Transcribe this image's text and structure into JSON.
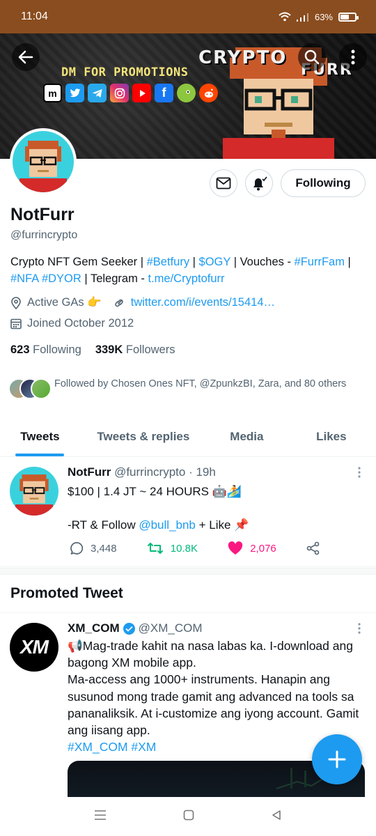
{
  "status_bar": {
    "time": "11:04",
    "battery": "63%"
  },
  "banner": {
    "title_line1": "CRYPTO",
    "title_line2": "FURR",
    "promo_text": "DM FOR PROMOTIONS",
    "social_icons": [
      "coinmarketcap-icon",
      "twitter-icon",
      "telegram-icon",
      "instagram-icon",
      "youtube-icon",
      "facebook-icon",
      "coingecko-icon",
      "reddit-icon"
    ]
  },
  "profile": {
    "name": "NotFurr",
    "handle": "@furrincrypto",
    "bio": {
      "part1": "Crypto NFT Gem Seeker | ",
      "tag_betfury": "#Betfury",
      "part2": "  | ",
      "tag_ogy": "$OGY",
      "part3": " | Vouches - ",
      "tag_furrfam": "#FurrFam",
      "part4": " | ",
      "tag_nfa": "#NFA",
      "part5": " ",
      "tag_dyor": "#DYOR",
      "part6": " | Telegram - ",
      "link_telegram": "t.me/Cryptofurr"
    },
    "location": "Active GAs 👉",
    "website": "twitter.com/i/events/15414…",
    "joined": "Joined October 2012",
    "following_count": "623",
    "following_label": "Following",
    "followers_count": "339K",
    "followers_label": "Followers",
    "followed_by": "Followed by Chosen Ones NFT, @ZpunkzBI, Zara, and 80 others",
    "following_button": "Following"
  },
  "tabs": [
    "Tweets",
    "Tweets & replies",
    "Media",
    "Likes"
  ],
  "tweet": {
    "name": "NotFurr",
    "handle": "@furrincrypto",
    "time": "· 19h",
    "line1": "$100 | 1.4 JT ~ 24 HOURS 🤖🏄",
    "line2_prefix": "-RT & Follow ",
    "line2_mention": "@bull_bnb",
    "line2_suffix": " + Like 📌",
    "replies": "3,448",
    "retweets": "10.8K",
    "likes": "2,076",
    "colors": {
      "retweet": "#00ba7c",
      "like": "#f91880"
    }
  },
  "promoted": {
    "section_title": "Promoted Tweet",
    "avatar_text": "XM",
    "name": "XM_COM",
    "handle": "@XM_COM",
    "line1": "📢Mag-trade kahit na nasa labas ka. I-download ang bagong XM mobile app.",
    "line2": "Ma-access ang 1000+ instruments. Hanapin ang susunod mong trade gamit ang advanced na tools sa pananaliksik. At i-customize ang iyong account. Gamit ang iisang app.",
    "hashtags": "#XM_COM #XM"
  },
  "colors": {
    "status_bar": "#8a4d1f",
    "accent": "#1d9bf0",
    "avatar_bg": "#3ad1de"
  }
}
